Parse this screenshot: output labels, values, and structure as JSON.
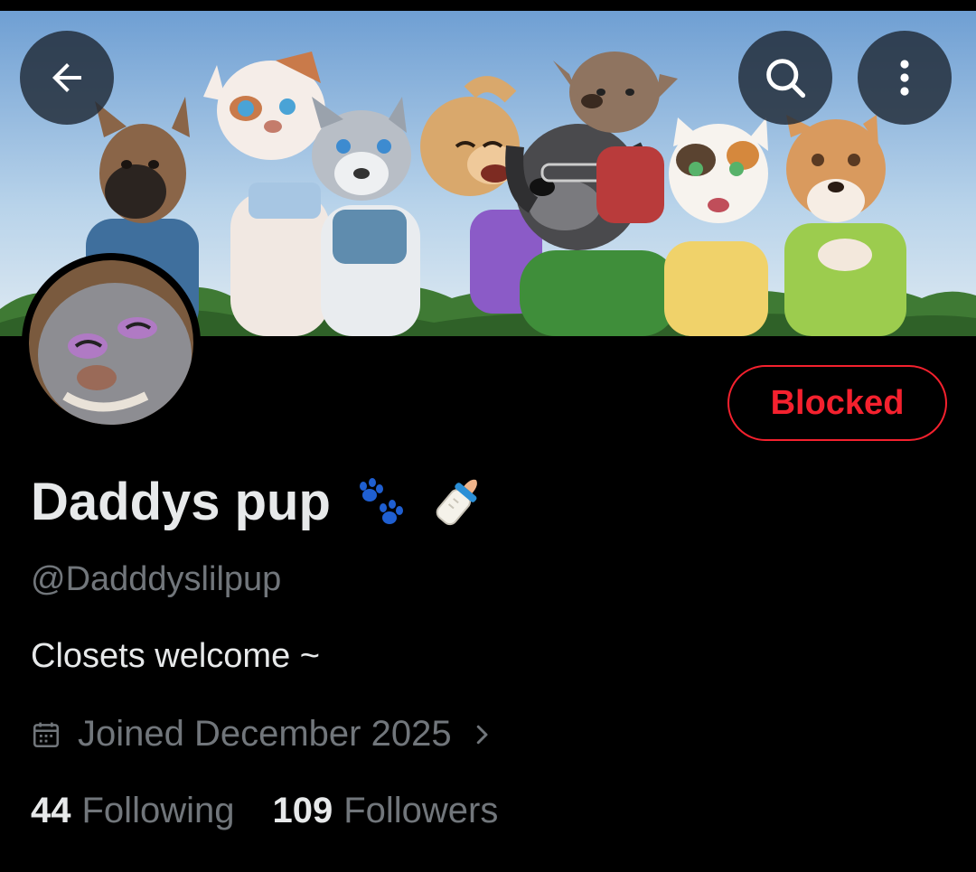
{
  "profile": {
    "display_name": "Daddys pup",
    "name_emoji": [
      "paw-prints-emoji",
      "baby-bottle-emoji"
    ],
    "handle": "@Dadddyslilpup",
    "bio": "Closets welcome ~",
    "joined": "Joined December 2025",
    "following_count": "44",
    "following_label": "Following",
    "followers_count": "109",
    "followers_label": "Followers"
  },
  "actions": {
    "relationship_button": "Blocked"
  },
  "icons": {
    "back": "arrow-left-icon",
    "search": "search-icon",
    "more": "more-vertical-icon",
    "calendar": "calendar-icon",
    "chevron": "chevron-right-icon"
  },
  "colors": {
    "background": "#000000",
    "primary_text": "#e7e9ea",
    "secondary_text": "#71767b",
    "blocked_red": "#f4212e",
    "paw_blue": "#1f5fd1"
  }
}
